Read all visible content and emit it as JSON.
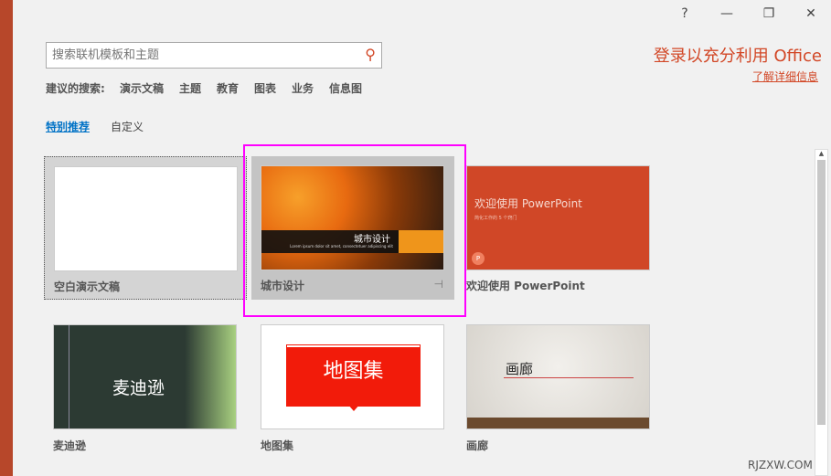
{
  "window": {
    "help": "?",
    "minimize": "—",
    "restore": "❐",
    "close": "✕"
  },
  "search": {
    "placeholder": "搜索联机模板和主题"
  },
  "suggested": {
    "label": "建议的搜索:",
    "items": [
      "演示文稿",
      "主题",
      "教育",
      "图表",
      "业务",
      "信息图"
    ]
  },
  "tabs": [
    {
      "label": "特别推荐",
      "active": true
    },
    {
      "label": "自定义",
      "active": false
    }
  ],
  "account": {
    "signin": "登录以充分利用 Office",
    "learn_more": "了解详细信息"
  },
  "templates": [
    {
      "name": "空白演示文稿"
    },
    {
      "name": "城市设计",
      "thumb_title": "城市设计",
      "thumb_sub": "Lorem ipsum dolor sit amet, consectetuer adipiscing elit"
    },
    {
      "name": "欢迎使用 PowerPoint",
      "thumb_title": "欢迎使用 PowerPoint",
      "thumb_sub": "简化工作的 5 个窍门"
    },
    {
      "name": "麦迪逊",
      "thumb_title": "麦迪逊"
    },
    {
      "name": "地图集",
      "thumb_title": "地图集"
    },
    {
      "name": "画廊",
      "thumb_title": "画廊"
    }
  ],
  "watermark": "RJZXW.COM",
  "colors": {
    "accent": "#d24726",
    "highlight": "#ff00ff",
    "link": "#0072c6"
  }
}
